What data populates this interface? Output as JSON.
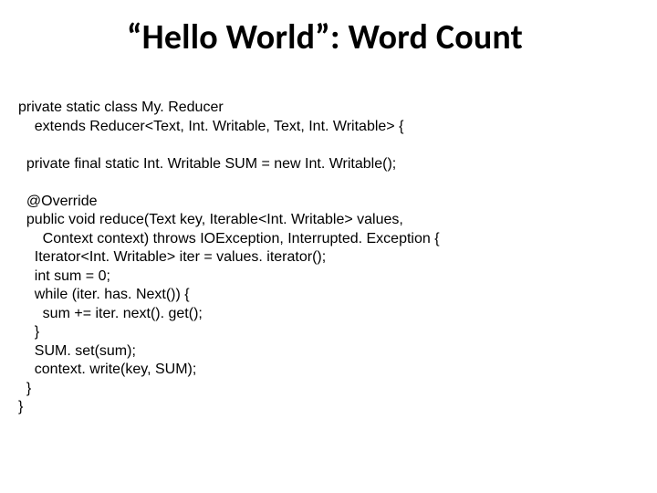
{
  "title": "“Hello World”: Word Count",
  "code": {
    "l1": "private static class My. Reducer",
    "l2": "    extends Reducer<Text, Int. Writable, Text, Int. Writable> {",
    "l3": "",
    "l4": "  private final static Int. Writable SUM = new Int. Writable();",
    "l5": "",
    "l6": "  @Override",
    "l7": "  public void reduce(Text key, Iterable<Int. Writable> values,",
    "l8": "      Context context) throws IOException, Interrupted. Exception {",
    "l9": "    Iterator<Int. Writable> iter = values. iterator();",
    "l10": "    int sum = 0;",
    "l11": "    while (iter. has. Next()) {",
    "l12": "      sum += iter. next(). get();",
    "l13": "    }",
    "l14": "    SUM. set(sum);",
    "l15": "    context. write(key, SUM);",
    "l16": "  }",
    "l17": "}"
  }
}
